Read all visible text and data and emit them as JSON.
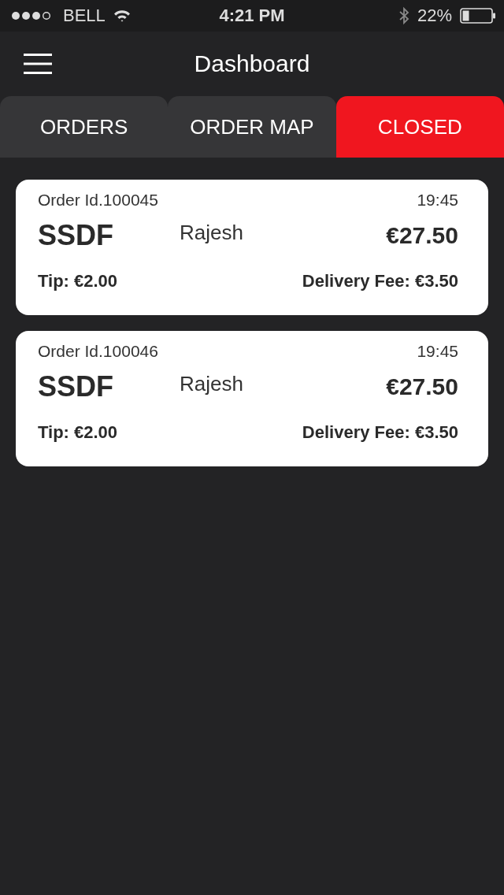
{
  "status_bar": {
    "carrier": "BELL",
    "time": "4:21 PM",
    "battery": "22%"
  },
  "header": {
    "title": "Dashboard"
  },
  "tabs": [
    {
      "label": "ORDERS",
      "selected": false
    },
    {
      "label": "ORDER MAP",
      "selected": false
    },
    {
      "label": "CLOSED",
      "selected": true
    }
  ],
  "orders": [
    {
      "order_id": "Order Id.100045",
      "time": "19:45",
      "name": "SSDF",
      "customer": "Rajesh",
      "total": "€27.50",
      "tip": "Tip: €2.00",
      "delivery_fee": "Delivery Fee: €3.50"
    },
    {
      "order_id": "Order Id.100046",
      "time": "19:45",
      "name": "SSDF",
      "customer": "Rajesh",
      "total": "€27.50",
      "tip": "Tip: €2.00",
      "delivery_fee": "Delivery Fee: €3.50"
    }
  ]
}
